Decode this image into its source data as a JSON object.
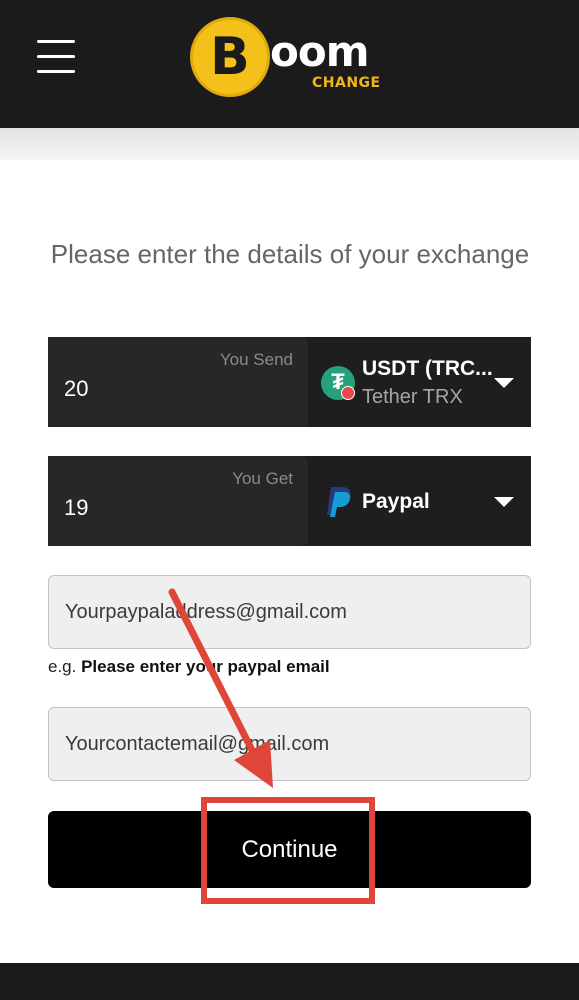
{
  "header": {
    "menu_icon": "hamburger-menu-icon",
    "logo": {
      "coin_glyph": "B",
      "word": "oom",
      "sub": "CHANGE",
      "coin_color": "#f3c11a",
      "accent_color": "#f3b51c"
    }
  },
  "form": {
    "title": "Please enter the details of your exchange",
    "send": {
      "label": "You Send",
      "amount": "20",
      "currency_name": "USDT (TRC...",
      "currency_network": "Tether TRX",
      "icon": "tether-icon"
    },
    "get": {
      "label": "You Get",
      "amount": "19",
      "currency_name": "Paypal",
      "icon": "paypal-icon"
    },
    "paypal_email": {
      "value": "Yourpaypaladdress@gmail.com"
    },
    "hint": {
      "prefix": "e.g.",
      "text": "Please enter your paypal email"
    },
    "contact_email": {
      "value": "Yourcontactemail@gmail.com"
    },
    "continue_label": "Continue"
  },
  "colors": {
    "header_bg": "#1b1b1b",
    "row_bg": "#1e1e1e",
    "button_bg": "#000000",
    "annotation": "#e0453a",
    "tether_green": "#26a17b"
  }
}
